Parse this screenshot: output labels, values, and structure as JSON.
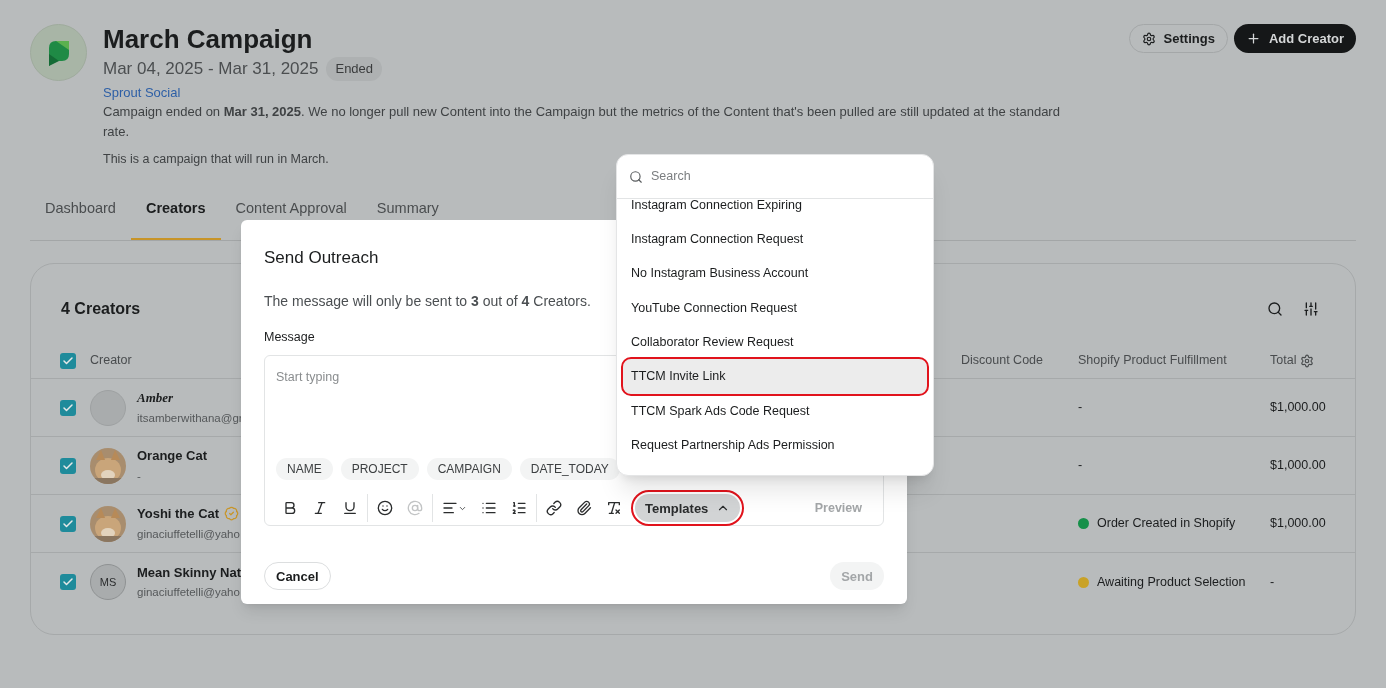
{
  "campaign": {
    "title": "March Campaign",
    "dates": "Mar 04, 2025 - Mar 31, 2025",
    "status": "Ended",
    "brand": "Sprout Social",
    "notice": "Campaign ended on **Mar 31, 2025**. We no longer pull new Content into the Campaign but the metrics of the Content that's been pulled are still updated at the standard rate.",
    "description": "This is a campaign that will run in March."
  },
  "header_buttons": [
    {
      "label": "Settings",
      "kind": "outline"
    },
    {
      "label": "Add Creator",
      "kind": "primary"
    }
  ],
  "tabs": [
    {
      "label": "Dashboard",
      "selected": false
    },
    {
      "label": "Creators",
      "selected": true
    },
    {
      "label": "Content Approval",
      "selected": false
    },
    {
      "label": "Summary",
      "selected": false
    }
  ],
  "creators_panel": {
    "title": "4 Creators",
    "header_checked": true,
    "columns": [
      {
        "label": "Creator"
      },
      {
        "label": "Discount Code"
      },
      {
        "label": "Shopify Product Fulfillment"
      },
      {
        "label": "Total"
      }
    ],
    "rows": [
      {
        "name": "Amber",
        "subtitle": "itsamberwithana@gr",
        "avatar": {
          "kind": "blank"
        },
        "verified": false,
        "checked": true,
        "fulfillment": {
          "text": "-"
        },
        "total": "$1,000.00"
      },
      {
        "name": "Orange Cat",
        "subtitle": "-",
        "verified": false,
        "checked": true,
        "fulfillment": {
          "text": "-"
        },
        "total": "$1,000.00"
      },
      {
        "name": "Yoshi the Cat",
        "subtitle": "ginaciuffetelli@yaho",
        "verified": true,
        "checked": true,
        "fulfillment": {
          "text": "Order Created in Shopify",
          "color": "#16904a"
        },
        "total": "$1,000.00"
      },
      {
        "name": "Mean Skinny Nat",
        "subtitle": "ginaciuffetelli@yaho",
        "avatar": {
          "kind": "initials",
          "initials": "MS"
        },
        "verified": false,
        "checked": true,
        "fulfillment": {
          "text": "Awaiting Product Selection",
          "color": "#c9a227"
        },
        "total": "-"
      }
    ]
  },
  "modal": {
    "title": "Send Outreach",
    "info": "The message will only be sent to **3** out of **4** Creators.",
    "message_label": "Message",
    "placeholder": "Start typing",
    "variables": [
      "NAME",
      "PROJECT",
      "CAMPAIGN",
      "DATE_TODAY"
    ],
    "templates_button": {
      "label": "Templates",
      "expanded": true,
      "annotated": true
    },
    "preview": {
      "label": "Preview",
      "disabled": true
    },
    "cancel": "Cancel",
    "send": {
      "label": "Send",
      "disabled": true
    }
  },
  "template_menu": {
    "search_placeholder": "Search",
    "items": [
      {
        "label": "Instagram Connection Expiring",
        "selected": false
      },
      {
        "label": "Instagram Connection Request",
        "selected": false
      },
      {
        "label": "No Instagram Business Account",
        "selected": false
      },
      {
        "label": "YouTube Connection Request",
        "selected": false
      },
      {
        "label": "Collaborator Review Request",
        "selected": false
      },
      {
        "label": "TTCM Invite Link",
        "selected": true
      },
      {
        "label": "TTCM Spark Ads Code Request",
        "selected": false
      },
      {
        "label": "Request Partnership Ads Permission",
        "selected": false
      }
    ]
  }
}
